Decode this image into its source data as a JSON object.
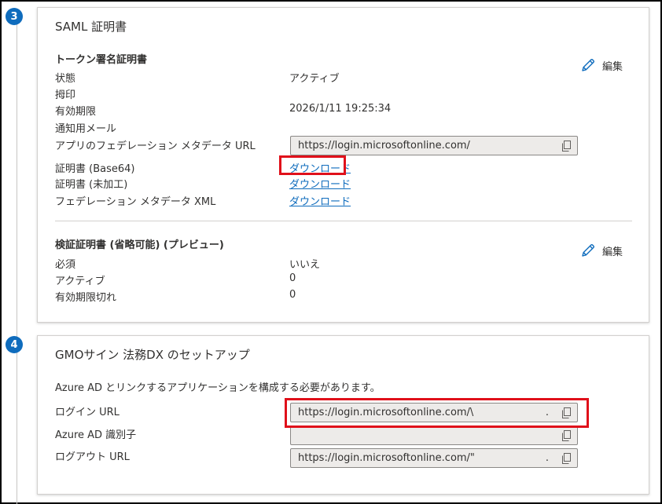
{
  "steps": [
    {
      "number": "3",
      "title": "SAML 証明書",
      "token_signing": {
        "heading": "トークン署名証明書",
        "edit_label": "編集",
        "rows": {
          "status": {
            "label": "状態",
            "value": "アクティブ"
          },
          "thumbprint": {
            "label": "拇印",
            "value": ""
          },
          "expiration": {
            "label": "有効期限",
            "value": "2026/1/11 19:25:34"
          },
          "notification_email": {
            "label": "通知用メール",
            "value": ""
          },
          "metadata_url": {
            "label": "アプリのフェデレーション メタデータ URL",
            "value": "https://login.microsoftonline.com/"
          },
          "cert_base64": {
            "label": "証明書 (Base64)",
            "link": "ダウンロード"
          },
          "cert_raw": {
            "label": "証明書 (未加工)",
            "link": "ダウンロード"
          },
          "federation_xml": {
            "label": "フェデレーション メタデータ XML",
            "link": "ダウンロード"
          }
        }
      },
      "verification": {
        "heading": "検証証明書 (省略可能) (プレビュー)",
        "edit_label": "編集",
        "rows": {
          "required": {
            "label": "必須",
            "value": "いいえ"
          },
          "active": {
            "label": "アクティブ",
            "value": "0"
          },
          "expired": {
            "label": "有効期限切れ",
            "value": "0"
          }
        }
      }
    },
    {
      "number": "4",
      "title": "GMOサイン 法務DX のセットアップ",
      "description": "Azure AD とリンクするアプリケーションを構成する必要があります。",
      "rows": {
        "login_url": {
          "label": "ログイン URL",
          "value": "https://login.microsoftonline.com/\\",
          "suffix": "."
        },
        "identifier": {
          "label": "Azure AD 識別子",
          "value": ""
        },
        "logout_url": {
          "label": "ログアウト URL",
          "value": "https://login.microsoftonline.com/\"",
          "suffix": "."
        }
      }
    }
  ],
  "colors": {
    "accent": "#0f6cbd",
    "highlight": "#e0101a",
    "field_bg": "#edebe9"
  },
  "icons": {
    "edit": "pencil-icon",
    "copy": "copy-icon"
  }
}
